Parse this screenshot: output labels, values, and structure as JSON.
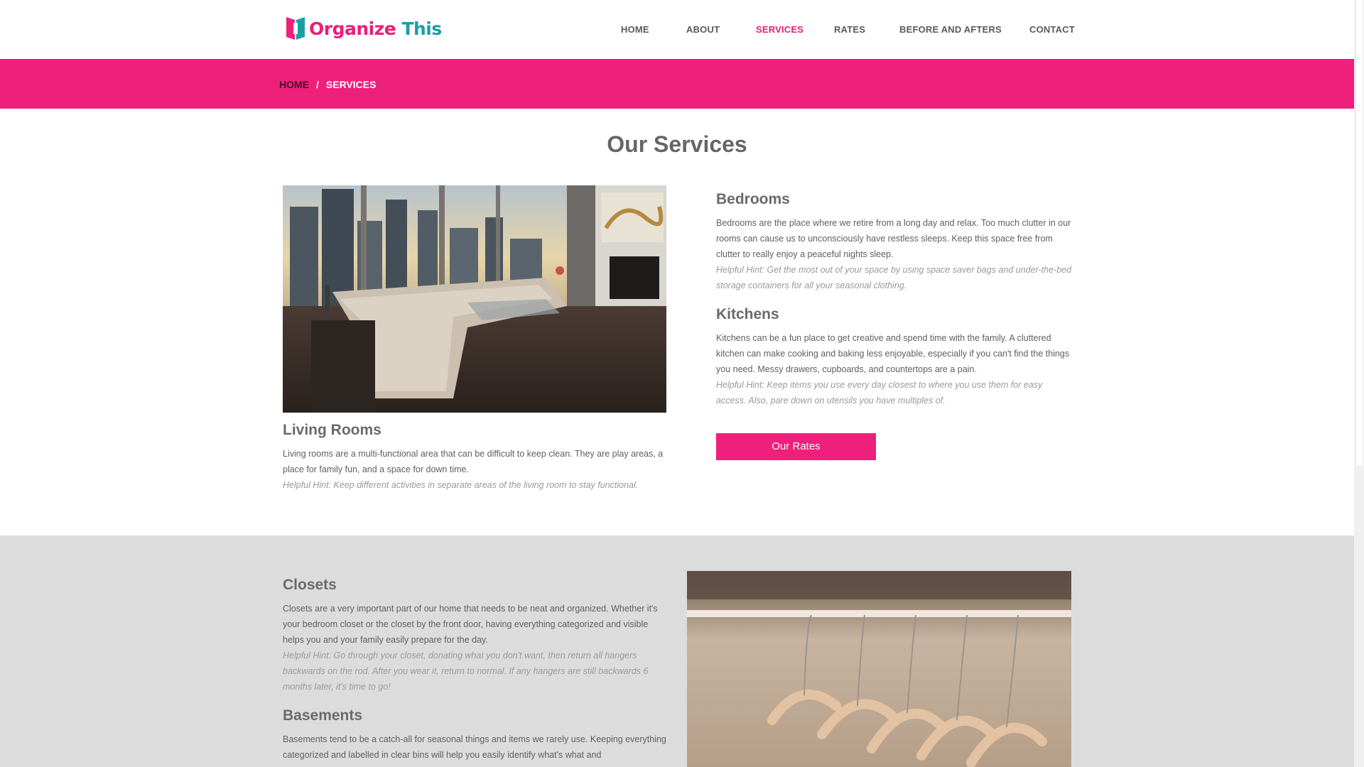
{
  "brand": {
    "name_part1": "Organize",
    "name_part2": "This",
    "colors": {
      "pink": "#ef1f7c",
      "teal": "#1a9fa6"
    }
  },
  "nav": {
    "items": [
      {
        "label": "HOME",
        "active": false
      },
      {
        "label": "ABOUT",
        "active": false
      },
      {
        "label": "SERVICES",
        "active": true
      },
      {
        "label": "RATES",
        "active": false
      },
      {
        "label": "BEFORE AND AFTERS",
        "active": false
      },
      {
        "label": "CONTACT",
        "active": false
      }
    ]
  },
  "breadcrumb": {
    "home": "HOME",
    "separator": "/",
    "current": "SERVICES"
  },
  "main": {
    "title": "Our Services",
    "living_rooms": {
      "heading": "Living Rooms",
      "text": "Living rooms are a multi-functional area that can be difficult to keep clean. They are play areas, a place for family fun, and a space for down time.",
      "hint": "Helpful Hint: Keep different activities in separate areas of the living room to stay functional."
    },
    "bedrooms": {
      "heading": "Bedrooms",
      "text": "Bedrooms are the place where we retire from a long day and relax. Too much clutter in our rooms can cause us to unconsciously have restless sleeps. Keep this space free from clutter to really enjoy a peaceful nights sleep.",
      "hint": "Helpful Hint: Get the most out of your space by using space saver bags and under-the-bed storage containers for all your seasonal clothing."
    },
    "kitchens": {
      "heading": "Kitchens",
      "text": "Kitchens can be a fun place to get creative and spend time with the family. A cluttered kitchen can make cooking and baking less enjoyable, especially if you can't find the things you need. Messy drawers, cupboards, and countertops are a pain.",
      "hint": "Helpful Hint: Keep items you use every day closest to where you use them for easy access. Also, pare down on utensils you have multiples of."
    },
    "rates_button": "Our Rates"
  },
  "secondary": {
    "closets": {
      "heading": "Closets",
      "text": "Closets are a very important part of our home that needs to be neat and organized. Whether it's your bedroom closet or the closet by the front door, having everything categorized and visible helps you and your family easily prepare for the day.",
      "hint": "Helpful Hint: Go through your closet, donating what you don't want, then return all hangers backwards on the rod. After you wear it, return to normal. If any hangers are still backwards 6 months later, it's time to go!"
    },
    "basements": {
      "heading": "Basements",
      "text": "Basements tend to be a catch-all for seasonal things and items we rarely use. Keeping everything categorized and labelled in clear bins will help you easily identify what's what and"
    }
  }
}
